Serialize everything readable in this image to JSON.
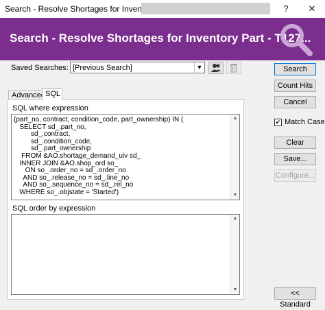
{
  "window": {
    "title": "Search - Resolve Shortages for Inventory Part - ",
    "help_glyph": "?",
    "close_glyph": "✕"
  },
  "banner": {
    "title": "Search - Resolve Shortages for Inventory Part - T127...",
    "color": "#7b2e8e",
    "icon": "magnifier-icon"
  },
  "saved_searches": {
    "label": "Saved Searches:",
    "value": "[Previous Search]"
  },
  "tabs": [
    {
      "label": "Advanced",
      "active": false
    },
    {
      "label": "SQL",
      "active": true
    }
  ],
  "sql": {
    "where_label": "SQL where expression",
    "where_text": "(part_no, contract, condition_code, part_ownership) IN (\n   SELECT sd_.part_no,\n         sd_.contract,\n         sd_.condition_code,\n         sd_.part_ownership\n    FROM &AO.shortage_demand_uiv sd_\n   INNER JOIN &AO.shop_ord so_\n      ON so_.order_no = sd_.order_no\n     AND so_.release_no = sd_.line_no\n     AND so_.sequence_no = sd_.rel_no\n   WHERE so_.objstate = 'Started')",
    "order_label": "SQL order by expression",
    "order_text": ""
  },
  "buttons": {
    "search": "Search",
    "count_hits": "Count Hits",
    "cancel": "Cancel",
    "clear": "Clear",
    "save": "Save...",
    "configure": "Configure...",
    "standard": "<< Standard"
  },
  "match_case": {
    "label": "Match Case",
    "checked": true
  }
}
